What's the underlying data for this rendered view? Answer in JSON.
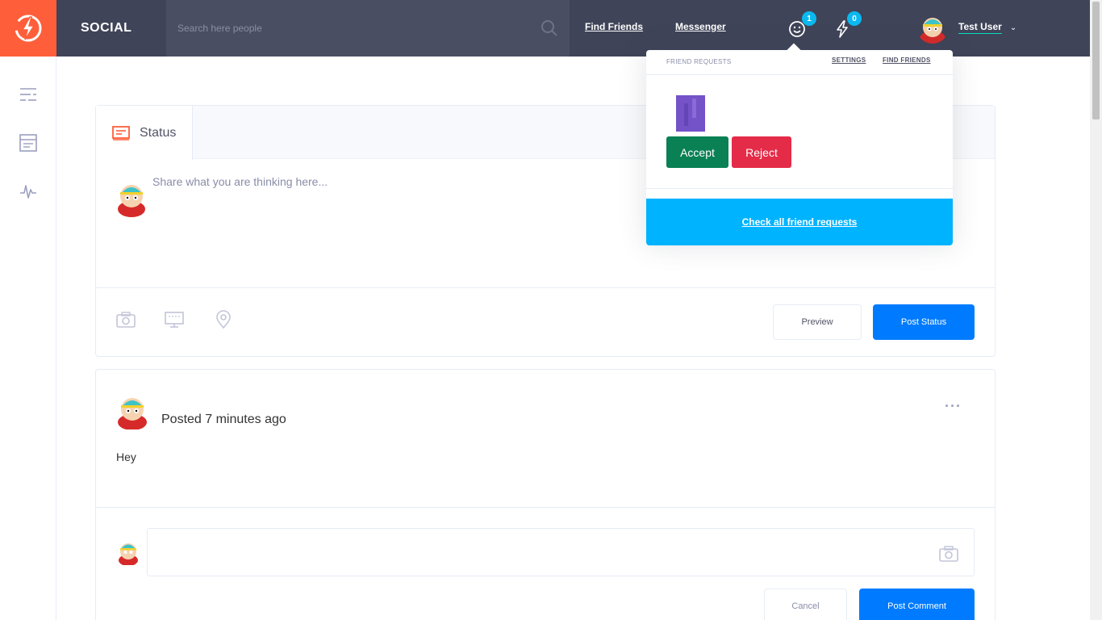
{
  "header": {
    "brand": "SOCIAL",
    "search_placeholder": "Search here people",
    "nav": {
      "find_friends": "Find Friends",
      "messenger": "Messenger"
    },
    "friend_requests_count": "1",
    "notifications_count": "0",
    "user_name": "Test User",
    "colors": {
      "logo_bg": "#ff5e3a",
      "topbar_bg": "#3f4458",
      "search_bg": "#494e62"
    }
  },
  "sidebar": {
    "icons": [
      "menu-lines-icon",
      "newsfeed-icon",
      "activity-icon"
    ]
  },
  "composer": {
    "tab_label": "Status",
    "placeholder": "Share what you are thinking here...",
    "tools": [
      "camera-icon",
      "computer-icon",
      "location-pin-icon"
    ],
    "preview_label": "Preview",
    "post_label": "Post Status"
  },
  "post": {
    "meta": "Posted 7 minutes ago",
    "text": "Hey",
    "more": "···",
    "comment_placeholder": "",
    "cancel_label": "Cancel",
    "post_comment_label": "Post Comment"
  },
  "dropdown": {
    "title": "FRIEND REQUESTS",
    "settings": "SETTINGS",
    "find_friends": "FIND FRIENDS",
    "accept": "Accept",
    "reject": "Reject",
    "check_all": "Check all friend requests",
    "colors": {
      "accept": "#0a8055",
      "reject": "#e42b48",
      "footer": "#00b3ff"
    }
  }
}
